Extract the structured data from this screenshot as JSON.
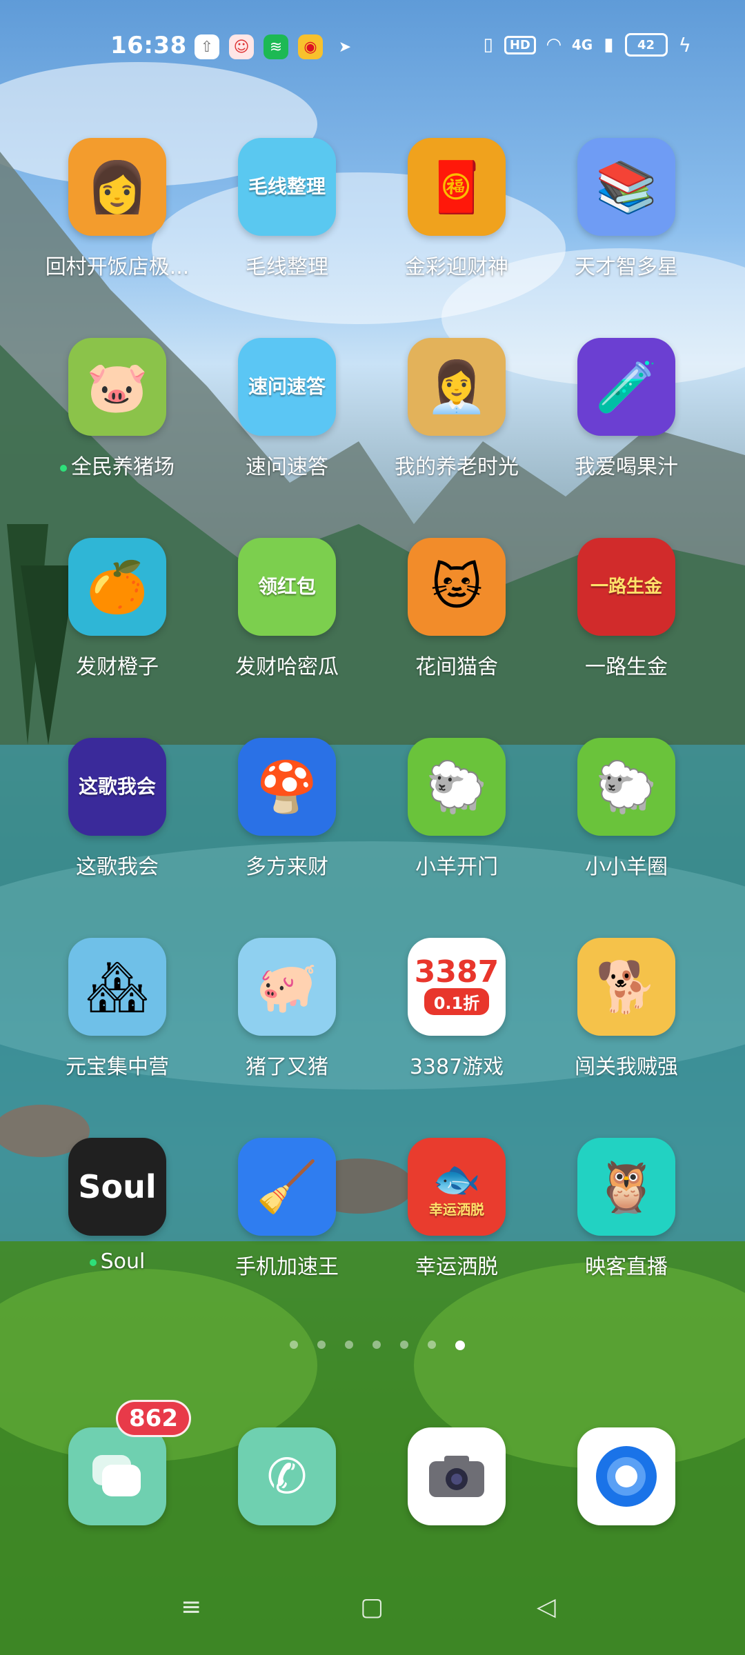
{
  "status_bar": {
    "time": "16:38",
    "notification_icons": [
      "upload-icon",
      "clown-app-icon",
      "spotify-icon",
      "weibo-icon",
      "send-icon"
    ],
    "hd": "HD",
    "network": "4G",
    "battery": "42"
  },
  "apps": [
    {
      "label": "回村开饭店极...",
      "icon": "restaurant-girl-icon",
      "bg": "#f39c2d"
    },
    {
      "label": "毛线整理",
      "icon": "yarn-girl-icon",
      "bg": "#5ac8f0",
      "text": "毛线整理"
    },
    {
      "label": "金彩迎财神",
      "icon": "fortune-god-icon",
      "bg": "#f0a21d"
    },
    {
      "label": "天才智多星",
      "icon": "books-icon",
      "bg": "#6f9cf4"
    },
    {
      "label": "全民养猪场",
      "icon": "pig-icon",
      "bg": "#8bc34a"
    },
    {
      "label": "速问速答",
      "icon": "quiz-icon",
      "bg": "#5bc6f4",
      "text": "速问速答"
    },
    {
      "label": "我的养老时光",
      "icon": "businesswoman-icon",
      "bg": "#e3b25a"
    },
    {
      "label": "我爱喝果汁",
      "icon": "juice-bottles-icon",
      "bg": "#6b3fd2"
    },
    {
      "label": "发财橙子",
      "icon": "orange-icon",
      "bg": "#2fb6d6"
    },
    {
      "label": "发财哈密瓜",
      "icon": "melon-icon",
      "bg": "#7ccf4e",
      "text": "领红包"
    },
    {
      "label": "花间猫舍",
      "icon": "cat-icon",
      "bg": "#f28c2a"
    },
    {
      "label": "一路生金",
      "icon": "golden-girl-icon",
      "bg": "#d12b2b",
      "text": "一路生金"
    },
    {
      "label": "这歌我会",
      "icon": "music-stage-icon",
      "bg": "#3a2a9a",
      "text": "这歌我会"
    },
    {
      "label": "多方来财",
      "icon": "mushroom-icon",
      "bg": "#2a71e6"
    },
    {
      "label": "小羊开门",
      "icon": "sheep-icon",
      "bg": "#6ac33b"
    },
    {
      "label": "小小羊圈",
      "icon": "sheep-icon",
      "bg": "#6ac33b"
    },
    {
      "label": "元宝集中营",
      "icon": "village-icon",
      "bg": "#6fc0e8"
    },
    {
      "label": "猪了又猪",
      "icon": "pigs-icon",
      "bg": "#8fd0f0"
    },
    {
      "label": "3387游戏",
      "icon": "3387-icon",
      "bg": "#ffffff",
      "text": "3387",
      "subtext": "0.1折"
    },
    {
      "label": "闯关我贼强",
      "icon": "shiba-icon",
      "bg": "#f5c24a"
    },
    {
      "label": "Soul",
      "icon": "soul-icon",
      "bg": "#202020",
      "text": "Soul"
    },
    {
      "label": "手机加速王",
      "icon": "broom-icon",
      "bg": "#2f7df0"
    },
    {
      "label": "幸运洒脱",
      "icon": "goldfish-icon",
      "bg": "#e93c2e",
      "text": "幸运洒脱"
    },
    {
      "label": "映客直播",
      "icon": "owl-icon",
      "bg": "#22d2c2"
    }
  ],
  "dock": [
    {
      "name": "messages",
      "icon": "chat-bubbles-icon",
      "bg": "#6fd0b0",
      "badge": "862"
    },
    {
      "name": "phone",
      "icon": "phone-icon",
      "bg": "#6fd0b0"
    },
    {
      "name": "camera",
      "icon": "camera-icon",
      "bg": "#ffffff"
    },
    {
      "name": "browser",
      "icon": "browser-icon",
      "bg": "#ffffff"
    }
  ],
  "pager": {
    "pages": 7,
    "active": 6
  }
}
